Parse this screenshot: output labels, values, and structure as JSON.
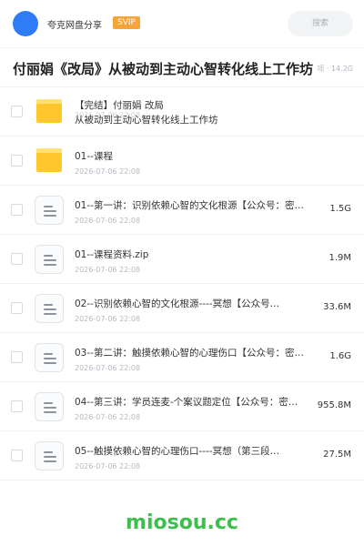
{
  "header": {
    "app_name": "夸克网盘分享",
    "badge": "SVIP",
    "search_placeholder": "搜索"
  },
  "title_bar": {
    "title": "付丽娟《改局》从被动到主动心智转化线上工作坊",
    "meta": "项 · 14.2G"
  },
  "files": [
    {
      "type": "folder",
      "name_line1": "【完结】付丽娟 改局",
      "name_line2": "从被动到主动心智转化线上工作坊",
      "date": "2026-07-06 22:08",
      "size": ""
    },
    {
      "type": "folder",
      "name": "01--课程",
      "date": "2026-07-06 22:08",
      "size": ""
    },
    {
      "type": "file",
      "name": "01--第一讲：识别依赖心智的文化根源【公众号：密…",
      "date": "2026-07-06 22:08",
      "size": "1.5G"
    },
    {
      "type": "file",
      "name": "01--课程资料.zip",
      "date": "2026-07-06 22:08",
      "size": "1.9M"
    },
    {
      "type": "file",
      "name": "02--识别依赖心智的文化根源----冥想【公众号…",
      "date": "2026-07-06 22:08",
      "size": "33.6M"
    },
    {
      "type": "file",
      "name": "03--第二讲：触摸依赖心智的心理伤口【公众号：密…",
      "date": "2026-07-06 22:08",
      "size": "1.6G"
    },
    {
      "type": "file",
      "name": "04--第三讲：学员连麦-个案议题定位【公众号：密…",
      "date": "2026-07-06 22:08",
      "size": "955.8M"
    },
    {
      "type": "file",
      "name": "05--触摸依赖心智的心理伤口----冥想（第三段…",
      "date": "2026-07-06 22:08",
      "size": "27.5M"
    }
  ],
  "watermark": "miosou.cc",
  "colors": {
    "avatar": "#2f7cf6",
    "svip": "#f6a33a",
    "folder": "#ffc72c",
    "watermark": "#3cbf4c"
  }
}
